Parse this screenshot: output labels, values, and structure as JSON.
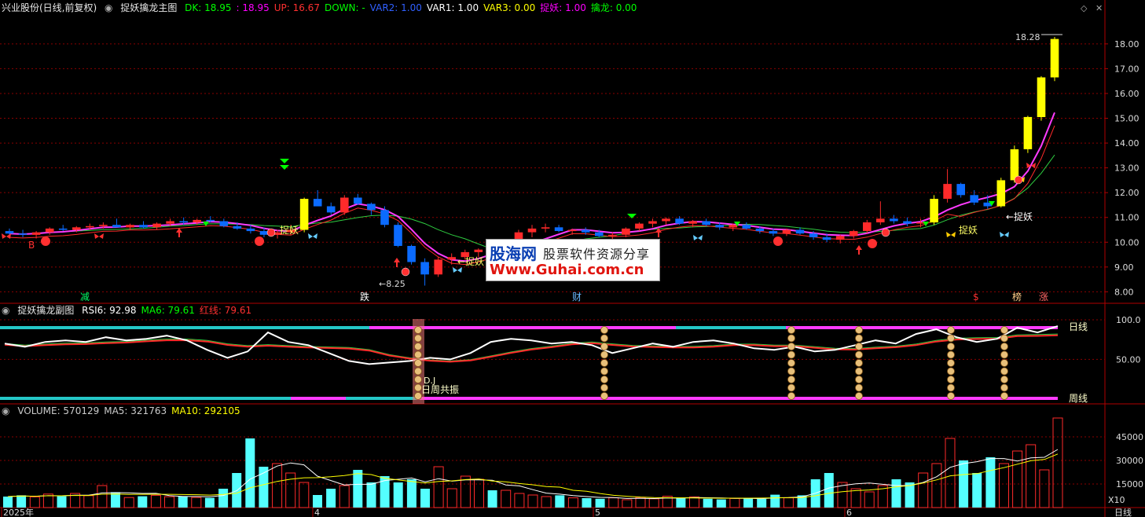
{
  "main_header": {
    "stock": "兴业股份(日线,前复权)",
    "indicator": "捉妖擒龙主图",
    "items": [
      {
        "text": "DK: 18.95",
        "color": "#00ff00"
      },
      {
        "text": ": 18.95",
        "color": "#ff00ff"
      },
      {
        "text": "UP: 16.67",
        "color": "#ff3030"
      },
      {
        "text": "DOWN: -",
        "color": "#00ff00"
      },
      {
        "text": "VAR2: 1.00",
        "color": "#3060ff"
      },
      {
        "text": "VAR1: 1.00",
        "color": "#ffffff"
      },
      {
        "text": "VAR3: 0.00",
        "color": "#ffff00"
      },
      {
        "text": "捉妖: 1.00",
        "color": "#ff00ff"
      },
      {
        "text": "擒龙: 0.00",
        "color": "#00ff00"
      }
    ]
  },
  "sub_header": {
    "indicator": "捉妖擒龙副图",
    "items": [
      {
        "text": "RSI6: 92.98",
        "color": "#ffffff"
      },
      {
        "text": "MA6: 79.61",
        "color": "#00ff00"
      },
      {
        "text": "红线: 79.61",
        "color": "#ff3030"
      }
    ]
  },
  "vol_header": {
    "items": [
      {
        "text": "VOLUME: 570129",
        "color": "#cccccc"
      },
      {
        "text": "MA5: 321763",
        "color": "#cccccc"
      },
      {
        "text": "MA10: 292105",
        "color": "#ffff00"
      }
    ]
  },
  "price_axis": [
    "18.00",
    "17.00",
    "16.00",
    "15.00",
    "14.00",
    "13.00",
    "12.00",
    "11.00",
    "10.00",
    "9.00",
    "8.00"
  ],
  "rsi_axis": [
    "100.0",
    "50.00"
  ],
  "vol_axis": [
    "45000",
    "30000",
    "15000"
  ],
  "vol_unit": "X10",
  "date_labels": [
    "2025年",
    "4",
    "5",
    "6"
  ],
  "period_label": "日线",
  "annotations": {
    "high": "18.28",
    "low": "8.25",
    "catch": "捉妖",
    "arrow_catch": "←捉妖",
    "b_mark": "B",
    "drop1": "减",
    "drop2": "跌",
    "cai": "财",
    "dollar": "$",
    "bang": "榜",
    "zhang": "涨",
    "day_line": "日线",
    "week_line": "周线",
    "resonance": "日周共振",
    "dj": "D.J"
  },
  "watermark": {
    "brand": "股海网",
    "slogan": "股票软件资源分享",
    "url": "Www.Guhai.com.cn"
  },
  "colors": {
    "up": "#ff2a2a",
    "down": "#0b6bff",
    "cyan_vol": "#54ffff",
    "grid": "#8a0000",
    "magenta": "#ff3bff"
  },
  "chart_data": {
    "type": "candlestick",
    "price_ylim": [
      7.6,
      19.2
    ],
    "candles": [
      [
        10.45,
        10.55,
        10.25,
        10.35
      ],
      [
        10.35,
        10.5,
        10.2,
        10.3
      ],
      [
        10.3,
        10.45,
        10.15,
        10.4
      ],
      [
        10.4,
        10.6,
        10.3,
        10.55
      ],
      [
        10.55,
        10.7,
        10.45,
        10.5
      ],
      [
        10.5,
        10.65,
        10.4,
        10.6
      ],
      [
        10.6,
        10.75,
        10.5,
        10.65
      ],
      [
        10.65,
        10.8,
        10.55,
        10.7
      ],
      [
        10.7,
        10.95,
        10.6,
        10.6
      ],
      [
        10.6,
        10.75,
        10.5,
        10.7
      ],
      [
        10.7,
        10.85,
        10.55,
        10.6
      ],
      [
        10.6,
        10.8,
        10.5,
        10.75
      ],
      [
        10.75,
        10.95,
        10.65,
        10.85
      ],
      [
        10.85,
        11.0,
        10.7,
        10.8
      ],
      [
        10.8,
        10.95,
        10.7,
        10.9
      ],
      [
        10.9,
        11.05,
        10.8,
        10.85
      ],
      [
        10.85,
        10.95,
        10.6,
        10.65
      ],
      [
        10.65,
        10.8,
        10.5,
        10.55
      ],
      [
        10.55,
        10.7,
        10.35,
        10.45
      ],
      [
        10.45,
        10.6,
        10.2,
        10.3
      ],
      [
        10.3,
        10.5,
        10.15,
        10.4
      ],
      [
        10.4,
        10.7,
        10.3,
        10.5
      ],
      [
        10.5,
        11.8,
        10.4,
        11.75
      ],
      [
        11.75,
        12.1,
        11.5,
        11.45
      ],
      [
        11.45,
        11.6,
        11.1,
        11.2
      ],
      [
        11.2,
        11.9,
        11.1,
        11.8
      ],
      [
        11.8,
        11.95,
        11.5,
        11.55
      ],
      [
        11.55,
        11.6,
        11.1,
        11.3
      ],
      [
        11.3,
        11.45,
        10.6,
        10.7
      ],
      [
        10.7,
        10.8,
        9.8,
        9.85
      ],
      [
        9.85,
        9.9,
        9.1,
        9.2
      ],
      [
        9.2,
        9.35,
        8.25,
        8.7
      ],
      [
        8.7,
        9.4,
        8.6,
        9.3
      ],
      [
        9.3,
        9.55,
        9.1,
        9.4
      ],
      [
        9.4,
        9.7,
        9.3,
        9.6
      ],
      [
        9.6,
        9.75,
        9.4,
        9.7
      ],
      [
        9.7,
        9.9,
        9.5,
        9.55
      ],
      [
        9.55,
        9.7,
        9.3,
        9.6
      ],
      [
        9.6,
        10.5,
        9.5,
        10.4
      ],
      [
        10.4,
        10.7,
        10.2,
        10.55
      ],
      [
        10.55,
        10.75,
        10.4,
        10.6
      ],
      [
        10.6,
        10.7,
        10.4,
        10.45
      ],
      [
        10.45,
        10.55,
        10.3,
        10.5
      ],
      [
        10.5,
        10.6,
        10.3,
        10.4
      ],
      [
        10.4,
        10.5,
        10.2,
        10.25
      ],
      [
        10.25,
        10.4,
        10.1,
        10.3
      ],
      [
        10.3,
        10.6,
        10.2,
        10.55
      ],
      [
        10.55,
        10.8,
        10.45,
        10.75
      ],
      [
        10.75,
        10.95,
        10.6,
        10.85
      ],
      [
        10.85,
        11.0,
        10.7,
        10.95
      ],
      [
        10.95,
        11.05,
        10.7,
        10.75
      ],
      [
        10.75,
        10.9,
        10.6,
        10.85
      ],
      [
        10.85,
        10.95,
        10.65,
        10.7
      ],
      [
        10.7,
        10.8,
        10.5,
        10.6
      ],
      [
        10.6,
        10.75,
        10.45,
        10.7
      ],
      [
        10.7,
        10.8,
        10.5,
        10.55
      ],
      [
        10.55,
        10.65,
        10.35,
        10.45
      ],
      [
        10.45,
        10.55,
        10.25,
        10.35
      ],
      [
        10.35,
        10.55,
        10.25,
        10.5
      ],
      [
        10.5,
        10.6,
        10.3,
        10.35
      ],
      [
        10.35,
        10.45,
        10.1,
        10.2
      ],
      [
        10.2,
        10.35,
        10.0,
        10.1
      ],
      [
        10.1,
        10.3,
        9.95,
        10.25
      ],
      [
        10.25,
        10.5,
        10.15,
        10.45
      ],
      [
        10.45,
        10.9,
        10.35,
        10.8
      ],
      [
        10.8,
        11.65,
        10.7,
        10.95
      ],
      [
        10.95,
        11.1,
        10.75,
        10.85
      ],
      [
        10.85,
        11.0,
        10.65,
        10.75
      ],
      [
        10.75,
        10.95,
        10.6,
        10.8
      ],
      [
        10.8,
        11.9,
        10.7,
        11.75
      ],
      [
        11.75,
        12.95,
        11.6,
        12.35
      ],
      [
        12.35,
        12.4,
        11.8,
        11.9
      ],
      [
        11.9,
        12.1,
        11.5,
        11.6
      ],
      [
        11.6,
        11.9,
        11.35,
        11.45
      ],
      [
        11.45,
        12.6,
        11.4,
        12.5
      ],
      [
        12.5,
        13.9,
        12.4,
        13.75
      ],
      [
        13.75,
        15.1,
        13.6,
        15.05
      ],
      [
        15.05,
        16.7,
        14.9,
        16.65
      ],
      [
        16.65,
        18.28,
        16.5,
        18.2
      ]
    ],
    "rsi6": [
      70,
      66,
      72,
      74,
      72,
      78,
      74,
      76,
      80,
      74,
      62,
      52,
      60,
      84,
      72,
      68,
      58,
      48,
      44,
      46,
      48,
      52,
      50,
      58,
      72,
      76,
      74,
      70,
      72,
      68,
      58,
      64,
      70,
      66,
      72,
      74,
      70,
      64,
      62,
      66,
      60,
      62,
      68,
      74,
      70,
      82,
      88,
      78,
      72,
      76,
      90,
      84,
      92
    ],
    "vol": [
      700,
      780,
      680,
      860,
      720,
      900,
      760,
      1400,
      980,
      640,
      720,
      780,
      690,
      700,
      640,
      620,
      1200,
      2200,
      4400,
      2600,
      2800,
      2200,
      1600,
      800,
      1200,
      1400,
      2400,
      1600,
      2000,
      1600,
      1800,
      1200,
      2600,
      1200,
      2000,
      1800,
      1100,
      1100,
      900,
      800,
      700,
      780,
      620,
      600,
      560,
      620,
      500,
      640,
      560,
      720,
      600,
      680,
      560,
      520,
      580,
      620,
      560,
      820,
      620,
      780,
      1800,
      2200,
      1600,
      1200,
      1000,
      1400,
      1800,
      1600,
      2200,
      2800,
      4400,
      3000,
      2200,
      3200,
      2800,
      3600,
      4000,
      2400,
      5700
    ]
  }
}
